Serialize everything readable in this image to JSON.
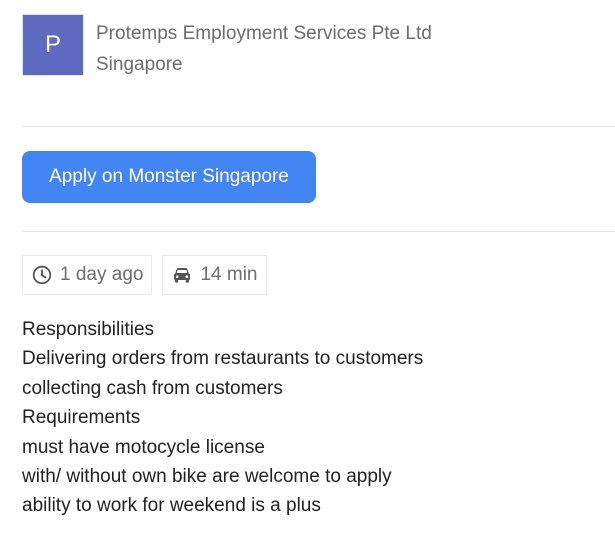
{
  "company": {
    "avatar_letter": "P",
    "avatar_color": "#5c6bc0",
    "name": "Protemps Employment Services Pte Ltd",
    "location": "Singapore"
  },
  "apply": {
    "label": "Apply on Monster Singapore",
    "color": "#4285f4"
  },
  "meta": {
    "posted": {
      "icon": "clock-icon",
      "text": "1 day ago"
    },
    "commute": {
      "icon": "car-icon",
      "text": "14 min"
    }
  },
  "description": {
    "lines": [
      "Responsibilities",
      "Delivering orders from restaurants to customers",
      "collecting cash from customers",
      "Requirements",
      "must have motocycle license",
      "with/ without own bike are welcome to apply",
      "ability to work for weekend is a plus"
    ]
  }
}
